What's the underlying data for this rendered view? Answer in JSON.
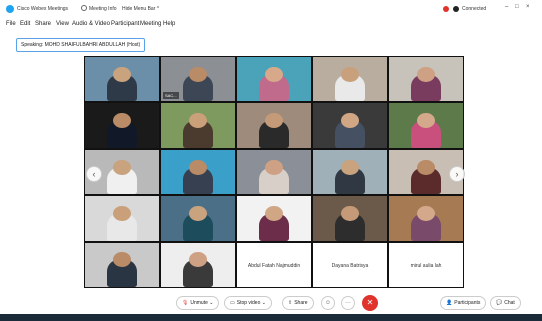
{
  "titlebar": {
    "app_name": "Cisco Webex Meetings",
    "meeting_info": "Meeting Info",
    "hide_menu_bar": "Hide Menu Bar ^",
    "status": "Connected",
    "minimize": "–",
    "maximize": "□",
    "close": "×"
  },
  "menu": {
    "file": "File",
    "edit": "Edit",
    "share": "Share",
    "view": "View",
    "audio_video": "Audio & Video",
    "participant": "Participant",
    "meeting": "Meeting",
    "help": "Help"
  },
  "speaking_label": "Speaking: MOHD SHAIFULBAHRI ABDULLAH (Host)",
  "tiles": [
    {
      "label": "",
      "bg": "#6b8fa8",
      "shirt": "#2f3a48",
      "skin": "#c9a27e"
    },
    {
      "label": "SAC...",
      "bg": "#8c8f94",
      "shirt": "#3c4654",
      "skin": "#b98b66"
    },
    {
      "label": "",
      "bg": "#4aa3b8",
      "shirt": "#c06b8c",
      "skin": "#d7a98a"
    },
    {
      "label": "",
      "bg": "#b8ad9e",
      "shirt": "#e9e9e9",
      "skin": "#c9a07c"
    },
    {
      "label": "",
      "bg": "#c7c2ba",
      "shirt": "#7a3c5e",
      "skin": "#cfa184"
    },
    {
      "label": "",
      "bg": "#1a1a1a",
      "shirt": "#111827",
      "skin": "#b98b66"
    },
    {
      "label": "",
      "bg": "#7f9a5e",
      "shirt": "#4b3a2e",
      "skin": "#caa07a"
    },
    {
      "label": "",
      "bg": "#9e8b7b",
      "shirt": "#2a2a2a",
      "skin": "#c49a78"
    },
    {
      "label": "",
      "bg": "#3a3a3a",
      "shirt": "#455163",
      "skin": "#d0a685"
    },
    {
      "label": "",
      "bg": "#5d7a4a",
      "shirt": "#c94f7d",
      "skin": "#d4a88a"
    },
    {
      "label": "",
      "bg": "#b9b9b9",
      "shirt": "#f0f0f0",
      "skin": "#c9a27e"
    },
    {
      "label": "",
      "bg": "#3aa0c9",
      "shirt": "#364050",
      "skin": "#b98b66"
    },
    {
      "label": "",
      "bg": "#8a8f98",
      "shirt": "#d8d0c8",
      "skin": "#cfa184"
    },
    {
      "label": "",
      "bg": "#9fb0b8",
      "shirt": "#303844",
      "skin": "#c9a27e"
    },
    {
      "label": "",
      "bg": "#c8beb4",
      "shirt": "#5b2a2a",
      "skin": "#b98b66"
    },
    {
      "label": "",
      "bg": "#d9d9d9",
      "shirt": "#e8e8e8",
      "skin": "#caa07a"
    },
    {
      "label": "",
      "bg": "#4b6f86",
      "shirt": "#1d4d5c",
      "skin": "#c9a27e"
    },
    {
      "label": "",
      "bg": "#f2f2f2",
      "shirt": "#6b2d4a",
      "skin": "#d0a685"
    },
    {
      "label": "",
      "bg": "#6b5a4a",
      "shirt": "#2d2d2d",
      "skin": "#c49a78"
    },
    {
      "label": "",
      "bg": "#a67b53",
      "shirt": "#7a4a6a",
      "skin": "#d4a88a"
    },
    {
      "label": "",
      "bg": "#c9c9c9",
      "shirt": "#2a3544",
      "skin": "#b98b66"
    },
    {
      "label": "",
      "bg": "#eeeeee",
      "shirt": "#3a3a3a",
      "skin": "#cfa184"
    }
  ],
  "blank_tiles": [
    {
      "name": "Abdul Fatah Najmuddin"
    },
    {
      "name": "Dayana Batrisya"
    },
    {
      "name": "mirul aulia lah"
    }
  ],
  "toolbar": {
    "unmute": "Unmute",
    "stop_video": "Stop video",
    "share": "Share",
    "participants": "Participants",
    "chat": "Chat"
  },
  "colors": {
    "end_button": "#e0332c",
    "accent": "#5aa3e8"
  }
}
